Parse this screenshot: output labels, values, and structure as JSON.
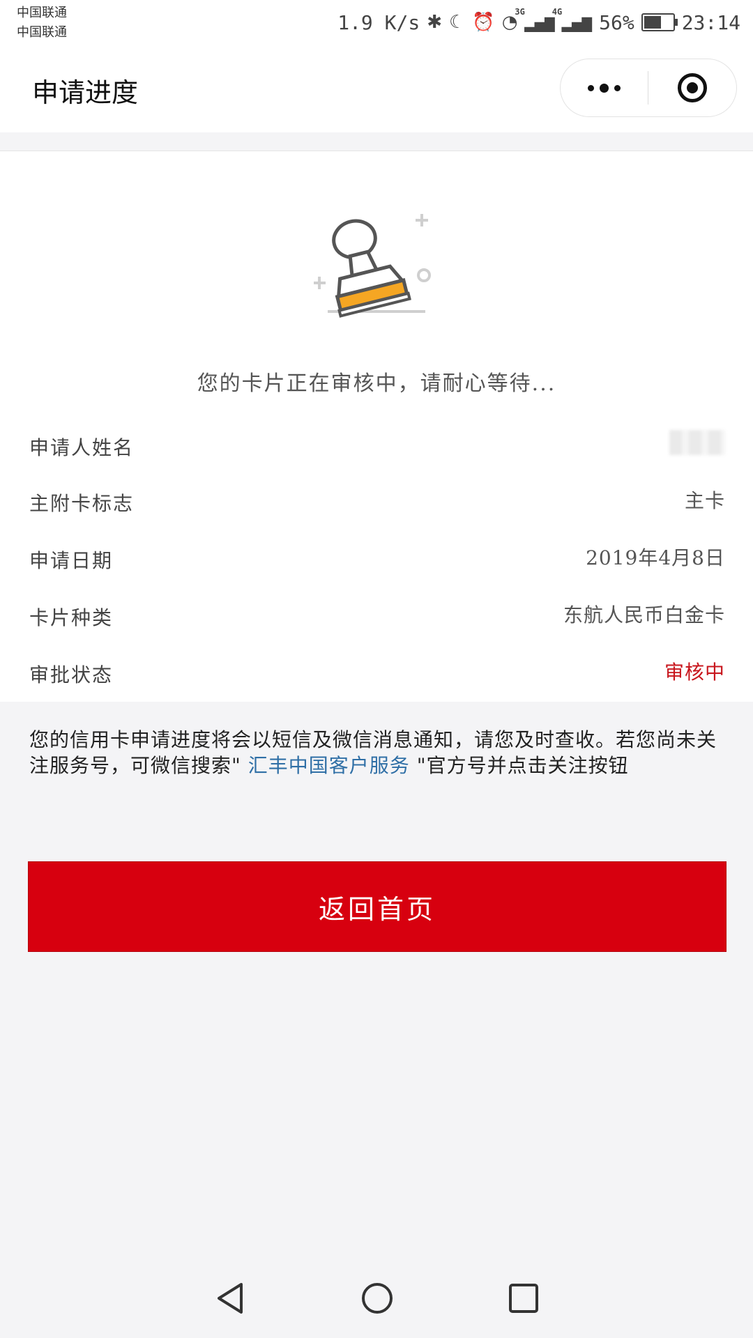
{
  "status_bar": {
    "carrier1": "中国联通",
    "carrier2": "中国联通",
    "speed": "1.9 K/s",
    "network_3g": "3G",
    "network_4g": "4G",
    "battery": "56%",
    "battery_level": 0.56,
    "time": "23:14",
    "icons": [
      "bluetooth-icon",
      "moon-icon",
      "alarm-icon",
      "wifi-icon",
      "signal-icon",
      "battery-icon"
    ]
  },
  "nav": {
    "title": "申请进度",
    "more_icon": "more-dots-icon",
    "close_icon": "target-icon"
  },
  "status_card": {
    "icon": "stamp-icon",
    "message": "您的卡片正在审核中，请耐心等待..."
  },
  "info_rows": [
    {
      "label": "申请人姓名",
      "value": ""
    },
    {
      "label": "主附卡标志",
      "value": "主卡"
    },
    {
      "label": "申请日期",
      "value": "2019年4月8日"
    },
    {
      "label": "卡片种类",
      "value": "东航人民币白金卡"
    },
    {
      "label": "审批状态",
      "value": "审核中"
    }
  ],
  "notice": {
    "text_before": "您的信用卡申请进度将会以短信及微信消息通知，请您及时查收。若您尚未关注服务号，可微信搜索\"",
    "link": " 汇丰中国客户服务 ",
    "text_after": "\"官方号并点击关注按钮"
  },
  "button": {
    "label": "返回首页"
  },
  "colors": {
    "accent": "#d7000f",
    "status_red": "#c8161d",
    "link": "#2f6fa6"
  }
}
